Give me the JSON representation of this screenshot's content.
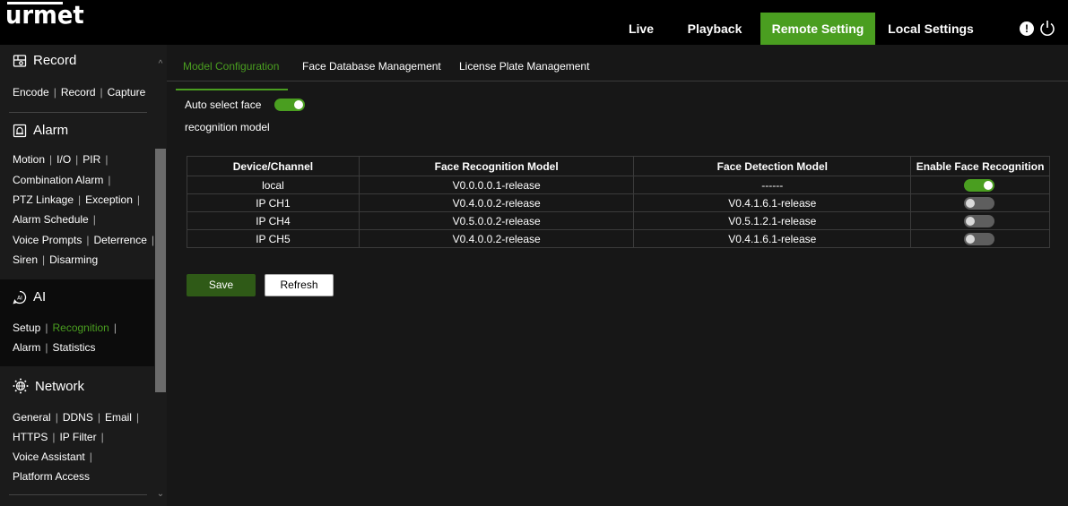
{
  "brand": {
    "logo_text": "urmet"
  },
  "nav": {
    "live": "Live",
    "playback": "Playback",
    "remote_setting": "Remote Setting",
    "local_settings": "Local Settings"
  },
  "colors": {
    "accent": "#4a9e20",
    "sidebar_bg": "#1b1b1b",
    "main_bg": "#171717",
    "save_button": "#2f5a17"
  },
  "header_icons": [
    "info-icon",
    "power-icon"
  ],
  "sidebar": {
    "record": {
      "title": "Record",
      "links": [
        "Encode",
        "Record",
        "Capture"
      ]
    },
    "alarm": {
      "title": "Alarm",
      "lines": [
        [
          "Motion",
          "I/O",
          "PIR"
        ],
        [
          "Combination Alarm"
        ],
        [
          "PTZ Linkage",
          "Exception"
        ],
        [
          "Alarm Schedule"
        ],
        [
          "Voice Prompts",
          "Deterrence"
        ],
        [
          "Siren",
          "Disarming"
        ]
      ]
    },
    "ai": {
      "title": "AI",
      "lines": [
        [
          "Setup",
          "Recognition"
        ],
        [
          "Alarm",
          "Statistics"
        ]
      ],
      "active": "Recognition"
    },
    "network": {
      "title": "Network",
      "lines": [
        [
          "General",
          "DDNS",
          "Email"
        ],
        [
          "HTTPS",
          "IP Filter"
        ],
        [
          "Voice Assistant"
        ],
        [
          "Platform Access"
        ]
      ]
    }
  },
  "tabs": {
    "model_configuration": "Model Configuration",
    "face_database": "Face Database Management",
    "license_plate": "License Plate Management",
    "active": "Model Configuration"
  },
  "auto_select": {
    "label_line1": "Auto select face",
    "label_line2": "recognition model",
    "enabled": true
  },
  "table": {
    "headers": [
      "Device/Channel",
      "Face Recognition Model",
      "Face Detection Model",
      "Enable Face Recognition"
    ],
    "rows": [
      {
        "channel": "local",
        "recognition_model": "V0.0.0.0.1-release",
        "detection_model": "------",
        "enabled": true
      },
      {
        "channel": "IP CH1",
        "recognition_model": "V0.4.0.0.2-release",
        "detection_model": "V0.4.1.6.1-release",
        "enabled": false
      },
      {
        "channel": "IP CH4",
        "recognition_model": "V0.5.0.0.2-release",
        "detection_model": "V0.5.1.2.1-release",
        "enabled": false
      },
      {
        "channel": "IP CH5",
        "recognition_model": "V0.4.0.0.2-release",
        "detection_model": "V0.4.1.6.1-release",
        "enabled": false
      }
    ]
  },
  "buttons": {
    "save": "Save",
    "refresh": "Refresh"
  }
}
